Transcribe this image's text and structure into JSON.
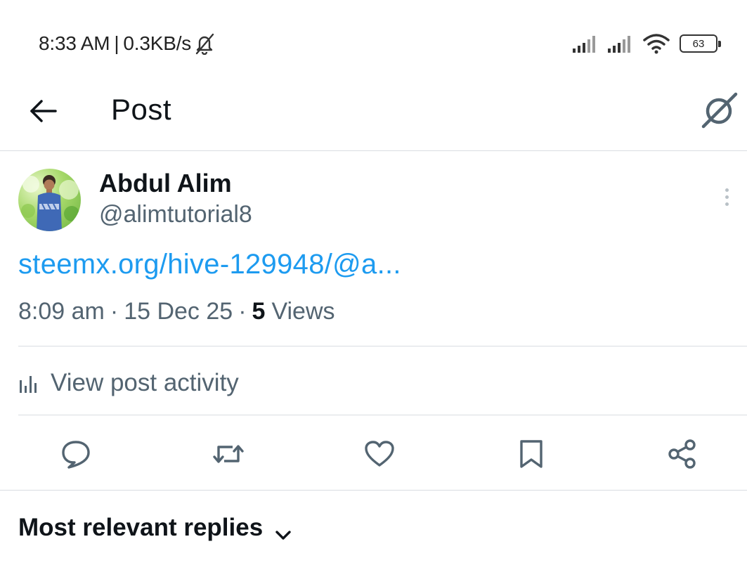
{
  "status_bar": {
    "time": "8:33 AM",
    "network_speed": "0.3KB/s",
    "separator": "|",
    "battery_level": "63",
    "icons": [
      "bell-off-icon",
      "signal-icon",
      "signal-icon",
      "wifi-icon",
      "battery-icon"
    ]
  },
  "header": {
    "title": "Post",
    "back_icon": "arrow-left-icon",
    "grok_icon": "grok-icon"
  },
  "post": {
    "author_name": "Abdul Alim",
    "author_handle": "@alimtutorial8",
    "link_text": "steemx.org/hive-129948/@a...",
    "time": "8:09 am",
    "date": "15 Dec 25",
    "meta_separator": "·",
    "views_count": "5",
    "views_label": "Views",
    "more_icon": "more-vertical-icon"
  },
  "activity": {
    "label": "View post activity",
    "icon": "bar-chart-icon"
  },
  "actions": [
    {
      "name": "reply",
      "icon": "reply-icon"
    },
    {
      "name": "repost",
      "icon": "repost-icon"
    },
    {
      "name": "like",
      "icon": "heart-icon"
    },
    {
      "name": "bookmark",
      "icon": "bookmark-icon"
    },
    {
      "name": "share",
      "icon": "share-icon"
    }
  ],
  "replies": {
    "sort_label": "Most relevant replies",
    "icon": "chevron-down-icon"
  },
  "colors": {
    "link": "#1d9bf0",
    "text_primary": "#0f1419",
    "text_secondary": "#536471",
    "divider": "#d9dde1"
  }
}
